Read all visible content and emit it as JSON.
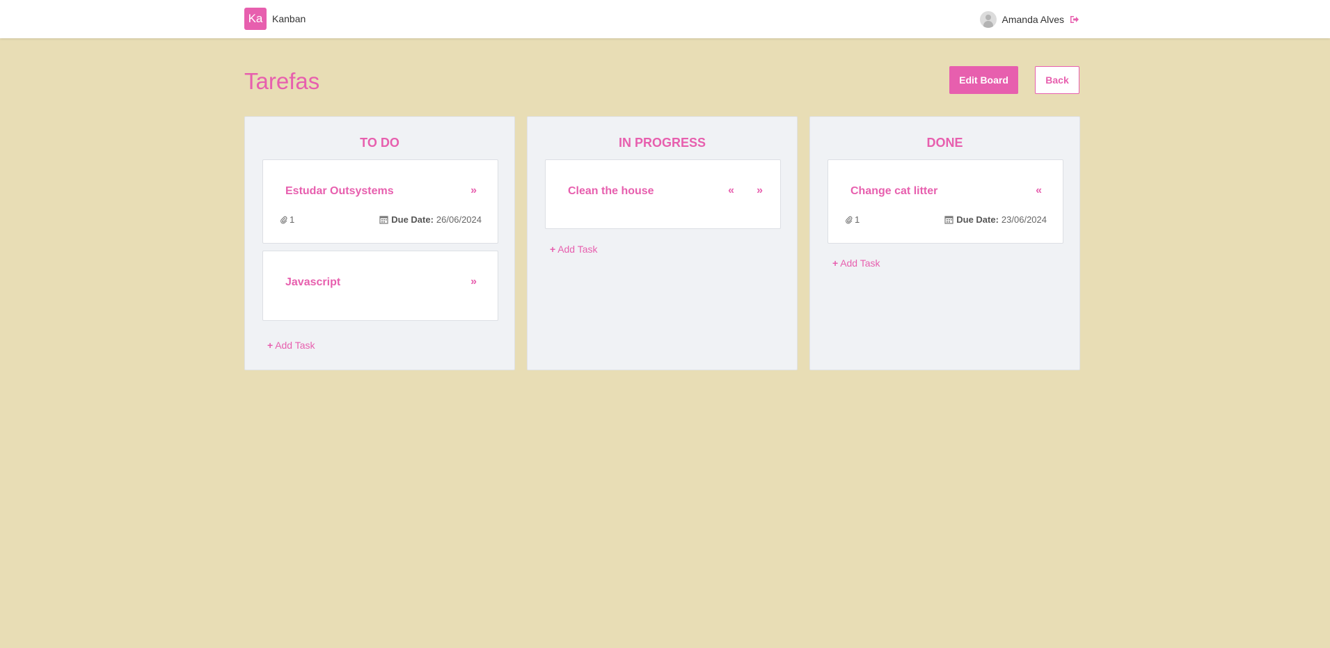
{
  "header": {
    "logo": "Ka",
    "app_name": "Kanban",
    "user_name": "Amanda Alves"
  },
  "page": {
    "title": "Tarefas",
    "edit_label": "Edit Board",
    "back_label": "Back"
  },
  "columns": [
    {
      "title": "TO DO",
      "add_label": "Add Task",
      "cards": [
        {
          "title": "Estudar Outsystems",
          "attachments": "1",
          "due_label": "Due Date:",
          "due_date": "26/06/2024"
        },
        {
          "title": "Javascript"
        }
      ]
    },
    {
      "title": "IN PROGRESS",
      "add_label": "Add Task",
      "cards": [
        {
          "title": "Clean the house"
        }
      ]
    },
    {
      "title": "DONE",
      "add_label": "Add Task",
      "cards": [
        {
          "title": "Change cat litter",
          "attachments": "1",
          "due_label": "Due Date:",
          "due_date": "23/06/2024"
        }
      ]
    }
  ],
  "icons": {
    "move_right": "»",
    "move_left": "«",
    "add": "+"
  },
  "colors": {
    "accent": "#e75fae",
    "background": "#e8ddb5",
    "column_bg": "#f0f2f5"
  }
}
